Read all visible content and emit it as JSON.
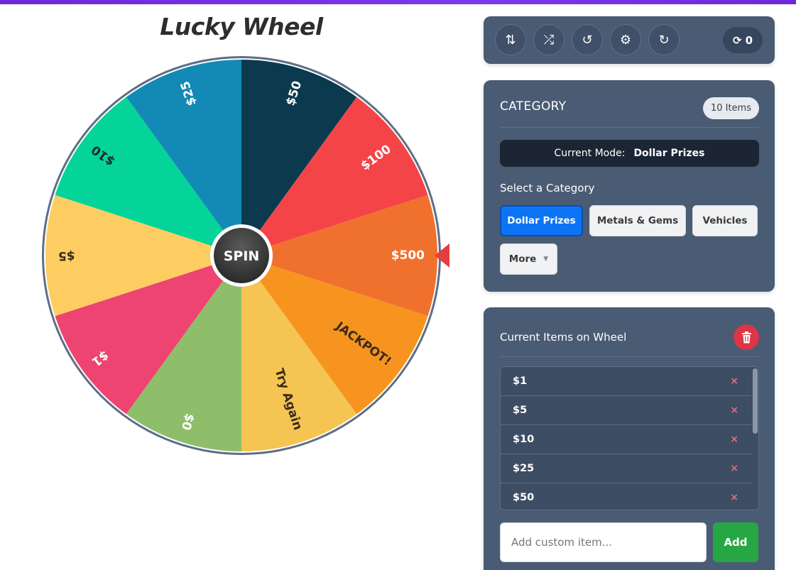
{
  "title": "Lucky Wheel",
  "wheel": {
    "spin_label": "SPIN",
    "segments": [
      {
        "label": "$50",
        "color": "#0b3a4f",
        "text_color": "#ffffff"
      },
      {
        "label": "$100",
        "color": "#f44448",
        "text_color": "#ffffff"
      },
      {
        "label": "$500",
        "color": "#f0712e",
        "text_color": "#ffffff"
      },
      {
        "label": "JACKPOT!",
        "color": "#f6941f",
        "text_color": "#3a2a1a"
      },
      {
        "label": "Try Again",
        "color": "#f6c452",
        "text_color": "#3a2a1a"
      },
      {
        "label": "$0",
        "color": "#8fbe6a",
        "text_color": "#ffffff"
      },
      {
        "label": "$1",
        "color": "#ee4472",
        "text_color": "#ffffff"
      },
      {
        "label": "$5",
        "color": "#fdcd62",
        "text_color": "#3a2a1a"
      },
      {
        "label": "$10",
        "color": "#05d49a",
        "text_color": "#1f2a2a"
      },
      {
        "label": "$25",
        "color": "#138ab5",
        "text_color": "#ffffff"
      }
    ]
  },
  "toolbar": {
    "buttons": [
      {
        "name": "sort-icon",
        "glyph": "⇅"
      },
      {
        "name": "shuffle-icon",
        "glyph": "⤮"
      },
      {
        "name": "history-icon",
        "glyph": "↺"
      },
      {
        "name": "gear-icon",
        "glyph": "⚙"
      },
      {
        "name": "redo-icon",
        "glyph": "↻"
      }
    ],
    "spin_count_icon": "⟳",
    "spin_count": "0"
  },
  "category": {
    "header": "CATEGORY",
    "count_badge": "10 Items",
    "mode_label": "Current Mode:",
    "mode_value": "Dollar Prizes",
    "select_label": "Select a Category",
    "buttons": [
      "Dollar Prizes",
      "Metals & Gems",
      "Vehicles",
      "More"
    ]
  },
  "items": {
    "header": "Current Items on Wheel",
    "list": [
      "$1",
      "$5",
      "$10",
      "$25",
      "$50"
    ],
    "remove_glyph": "×",
    "input_placeholder": "Add custom item...",
    "add_label": "Add"
  }
}
